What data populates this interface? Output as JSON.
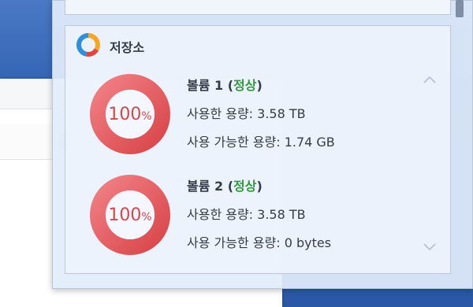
{
  "storage": {
    "title": "저장소",
    "icon": "storage-pie-icon",
    "colors": {
      "used": "#d9464a",
      "ok_status": "#2f9a3a"
    },
    "volumes": [
      {
        "name": "볼륨 1",
        "status": "정상",
        "usage_percent_number": "100",
        "usage_percent_sign": "%",
        "usage_fraction": 1.0,
        "used_line": "사용한 용량: 3.58 TB",
        "available_line": "사용 가능한 용량: 1.74 GB"
      },
      {
        "name": "볼륨 2",
        "status": "정상",
        "usage_percent_number": "100",
        "usage_percent_sign": "%",
        "usage_fraction": 1.0,
        "used_line": "사용한 용량: 3.58 TB",
        "available_line": "사용 가능한 용량: 0 bytes"
      }
    ]
  }
}
